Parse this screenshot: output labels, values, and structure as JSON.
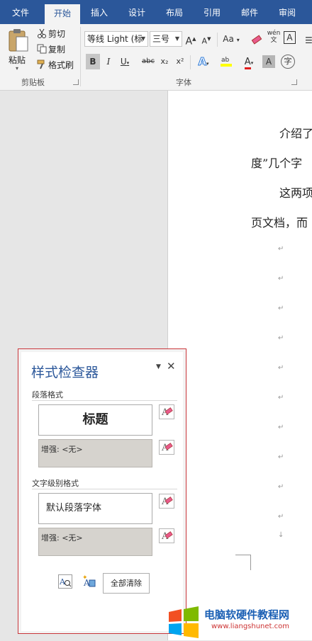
{
  "ribbon": {
    "tabs": [
      "文件",
      "开始",
      "插入",
      "设计",
      "布局",
      "引用",
      "邮件",
      "审阅"
    ],
    "active_tab": "开始",
    "clipboard": {
      "paste": "粘贴",
      "cut": "剪切",
      "copy": "复制",
      "format_painter": "格式刷",
      "group_label": "剪贴板"
    },
    "font": {
      "font_name": "等线 Light (标",
      "font_size": "三号",
      "grow": "A",
      "shrink": "A",
      "change_case": "Aa",
      "phonetic": "wén",
      "bold": "B",
      "italic": "I",
      "underline": "U",
      "strike": "abc",
      "subscript": "x₂",
      "superscript": "x²",
      "group_label": "字体"
    },
    "colors": {
      "tab_bar": "#2b579a",
      "font_color_red": "#e21d1d",
      "highlight_yellow": "#ffff00"
    }
  },
  "document": {
    "lines": [
      "介绍了",
      "度”几个字",
      "这两项",
      "页文档，而"
    ]
  },
  "style_inspector": {
    "title": "样式检查器",
    "paragraph_section": "段落格式",
    "paragraph_style": "标题",
    "paragraph_plus": "增强: <无>",
    "text_section": "文字级别格式",
    "text_style": "默认段落字体",
    "text_plus": "增强: <无>",
    "clear_all": "全部清除"
  },
  "watermark": {
    "brand": "电脑软硬件教程网",
    "url": "www.liangshunet.com"
  }
}
